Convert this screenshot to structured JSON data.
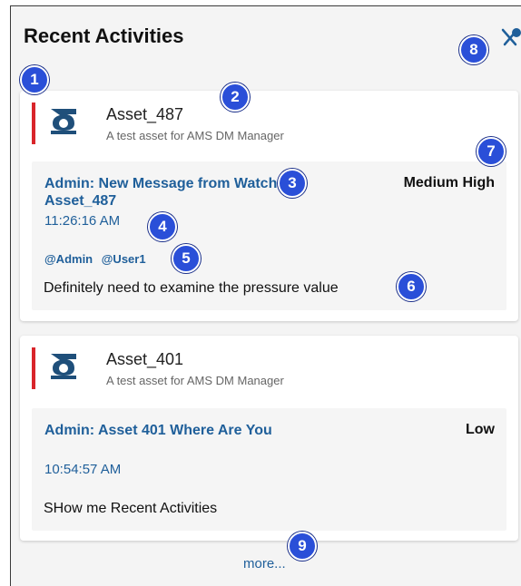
{
  "panel": {
    "title": "Recent Activities",
    "unpin_icon": "unpin-icon"
  },
  "activities": [
    {
      "asset_name": "Asset_487",
      "asset_description": "A test asset for AMS DM Manager",
      "asset_icon": "asset-logo-icon",
      "message_title": "Admin: New Message from Watched Asset_487",
      "time": "11:26:16 AM",
      "priority": "Medium High",
      "mentions": [
        "@Admin",
        "@User1"
      ],
      "body": "Definitely need to examine the pressure value",
      "accent_color": "#d9252a"
    },
    {
      "asset_name": "Asset_401",
      "asset_description": "A test asset for AMS DM Manager",
      "asset_icon": "asset-logo-icon",
      "message_title": "Admin: Asset 401 Where Are You",
      "time": "10:54:57 AM",
      "priority": "Low",
      "mentions": [],
      "body": "SHow me Recent Activities",
      "accent_color": "#d9252a"
    }
  ],
  "more_label": "more...",
  "callouts": [
    "1",
    "2",
    "3",
    "4",
    "5",
    "6",
    "7",
    "8",
    "9"
  ],
  "colors": {
    "link_blue": "#1f5f9a",
    "callout_blue": "#2a4fd8",
    "accent_red": "#d9252a",
    "panel_bg": "#f4f4f4"
  }
}
